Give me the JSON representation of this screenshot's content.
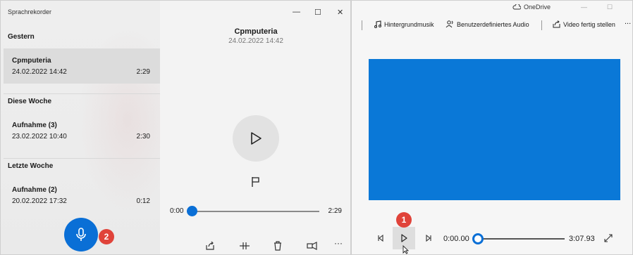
{
  "app": {
    "title": "Sprachrekorder"
  },
  "sections": [
    {
      "heading": "Gestern"
    },
    {
      "heading": "Diese Woche"
    },
    {
      "heading": "Letzte Woche"
    }
  ],
  "recordings": [
    {
      "name": "Cpmputeria",
      "date": "24.02.2022 14:42",
      "duration": "2:29",
      "selected": true
    },
    {
      "name": "Aufnahme (3)",
      "date": "23.02.2022 10:40",
      "duration": "2:30",
      "selected": false
    },
    {
      "name": "Aufnahme (2)",
      "date": "20.02.2022 17:32",
      "duration": "0:12",
      "selected": false
    }
  ],
  "detail": {
    "title": "Cpmputeria",
    "subtitle": "24.02.2022 14:42",
    "time_start": "0:00",
    "time_end": "2:29",
    "progress": 0.0
  },
  "badges": {
    "mic": "2",
    "play": "1"
  },
  "editor": {
    "onedrive": "OneDrive",
    "toolbar": {
      "music": "Hintergrundmusik",
      "audio": "Benutzerdefiniertes Audio",
      "finish": "Video fertig stellen",
      "more": "..."
    },
    "preview_color": "#0a78d7",
    "time_start": "0:00.00",
    "time_end": "3:07.93",
    "progress": 0.0
  },
  "colors": {
    "accent": "#0a6fd6",
    "badge": "#e0433a"
  }
}
